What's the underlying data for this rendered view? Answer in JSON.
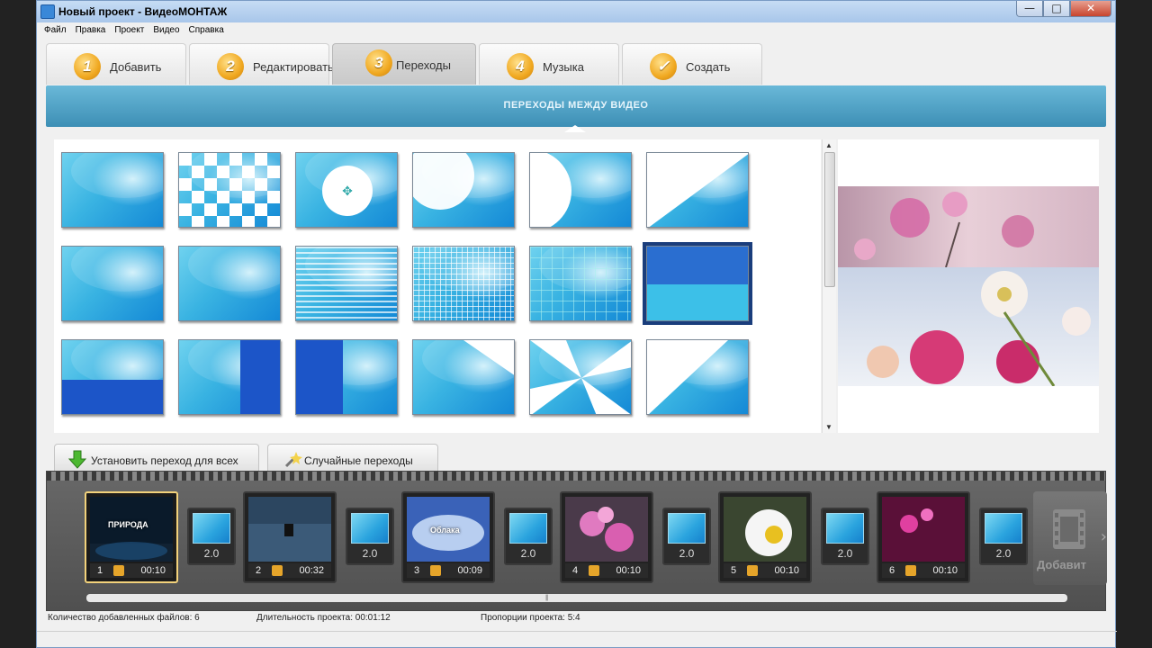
{
  "window": {
    "title": "Новый проект - ВидеоМОНТАЖ",
    "min": "—",
    "max": "□",
    "close": "✕"
  },
  "menu": [
    "Файл",
    "Правка",
    "Проект",
    "Видео",
    "Справка"
  ],
  "steps": [
    {
      "num": "1",
      "label": "Добавить"
    },
    {
      "num": "2",
      "label": "Редактировать"
    },
    {
      "num": "3",
      "label": "Переходы",
      "active": true
    },
    {
      "num": "4",
      "label": "Музыка"
    },
    {
      "num": "✓",
      "label": "Создать"
    }
  ],
  "banner": "ПЕРЕХОДЫ МЕЖДУ ВИДЕО",
  "transitions": {
    "selected_index": 11,
    "count": 18
  },
  "buttons": {
    "set_all": "Установить переход для всех",
    "random": "Случайные переходы"
  },
  "clips": [
    {
      "n": "1",
      "dur": "00:10",
      "title": "ПРИРОДА",
      "selected": true
    },
    {
      "n": "2",
      "dur": "00:32",
      "title": ""
    },
    {
      "n": "3",
      "dur": "00:09",
      "title": "Облака"
    },
    {
      "n": "4",
      "dur": "00:10",
      "title": ""
    },
    {
      "n": "5",
      "dur": "00:10",
      "title": ""
    },
    {
      "n": "6",
      "dur": "00:10",
      "title": ""
    }
  ],
  "transition_duration": "2.0",
  "add_clip": "Добавит",
  "status": {
    "files": "Количество добавленных файлов: 6",
    "duration": "Длительность проекта: 00:01:12",
    "ratio": "Пропорции проекта: 5:4"
  },
  "colors": {
    "banner": "#4ca3c7",
    "step_badge": "#f0a820",
    "selection": "#1a3d7c"
  }
}
